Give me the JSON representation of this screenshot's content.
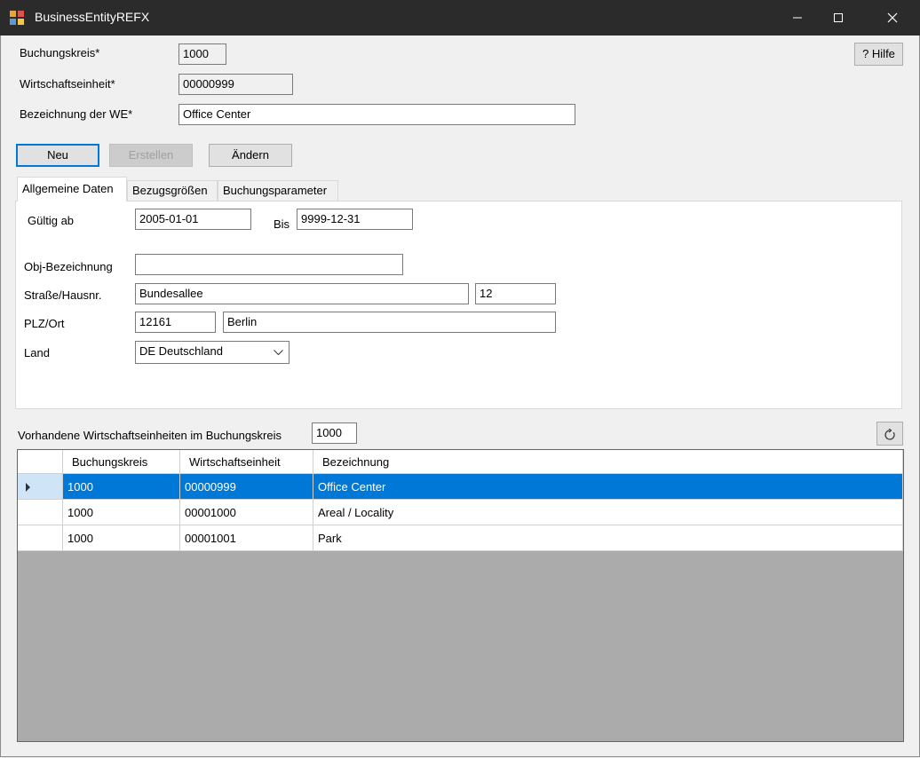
{
  "window": {
    "title": "BusinessEntityREFX",
    "controls": [
      "minimize",
      "maximize",
      "close"
    ]
  },
  "header": {
    "company_code_label": "Buchungskreis*",
    "company_code_value": "1000",
    "business_entity_label": "Wirtschaftseinheit*",
    "business_entity_value": "00000999",
    "description_label": "Bezeichnung der WE*",
    "description_value": "Office Center",
    "help_button": "? Hilfe"
  },
  "actions": {
    "new_label": "Neu",
    "create_label": "Erstellen",
    "change_label": "Ändern"
  },
  "tabs": [
    {
      "label": "Allgemeine Daten",
      "active": true
    },
    {
      "label": "Bezugsgrößen",
      "active": false
    },
    {
      "label": "Buchungsparameter",
      "active": false
    }
  ],
  "general": {
    "valid_from_label": "Gültig ab",
    "valid_from_value": "2005-01-01",
    "valid_to_label": "Bis",
    "valid_to_value": "9999-12-31",
    "obj_desc_label": "Obj-Bezeichnung",
    "obj_desc_value": "",
    "street_label": "Straße/Hausnr.",
    "street_value": "Bundesallee",
    "house_no_value": "12",
    "postal_label": "PLZ/Ort",
    "postal_value": "12161",
    "city_value": "Berlin",
    "country_label": "Land",
    "country_value": "DE Deutschland"
  },
  "list": {
    "label": "Vorhandene Wirtschaftseinheiten im Buchungskreis",
    "company_code_value": "1000",
    "refresh_icon": "refresh-icon",
    "columns": [
      "Buchungskreis",
      "Wirtschaftseinheit",
      "Bezeichnung"
    ],
    "rows": [
      {
        "cells": [
          "1000",
          "00000999",
          "Office Center"
        ],
        "selected": true
      },
      {
        "cells": [
          "1000",
          "00001000",
          "Areal / Locality"
        ],
        "selected": false
      },
      {
        "cells": [
          "1000",
          "00001001",
          "Park"
        ],
        "selected": false
      }
    ]
  },
  "colors": {
    "titlebar": "#2b2b2b",
    "selection": "#0078d7",
    "grid_background": "#ababab"
  }
}
